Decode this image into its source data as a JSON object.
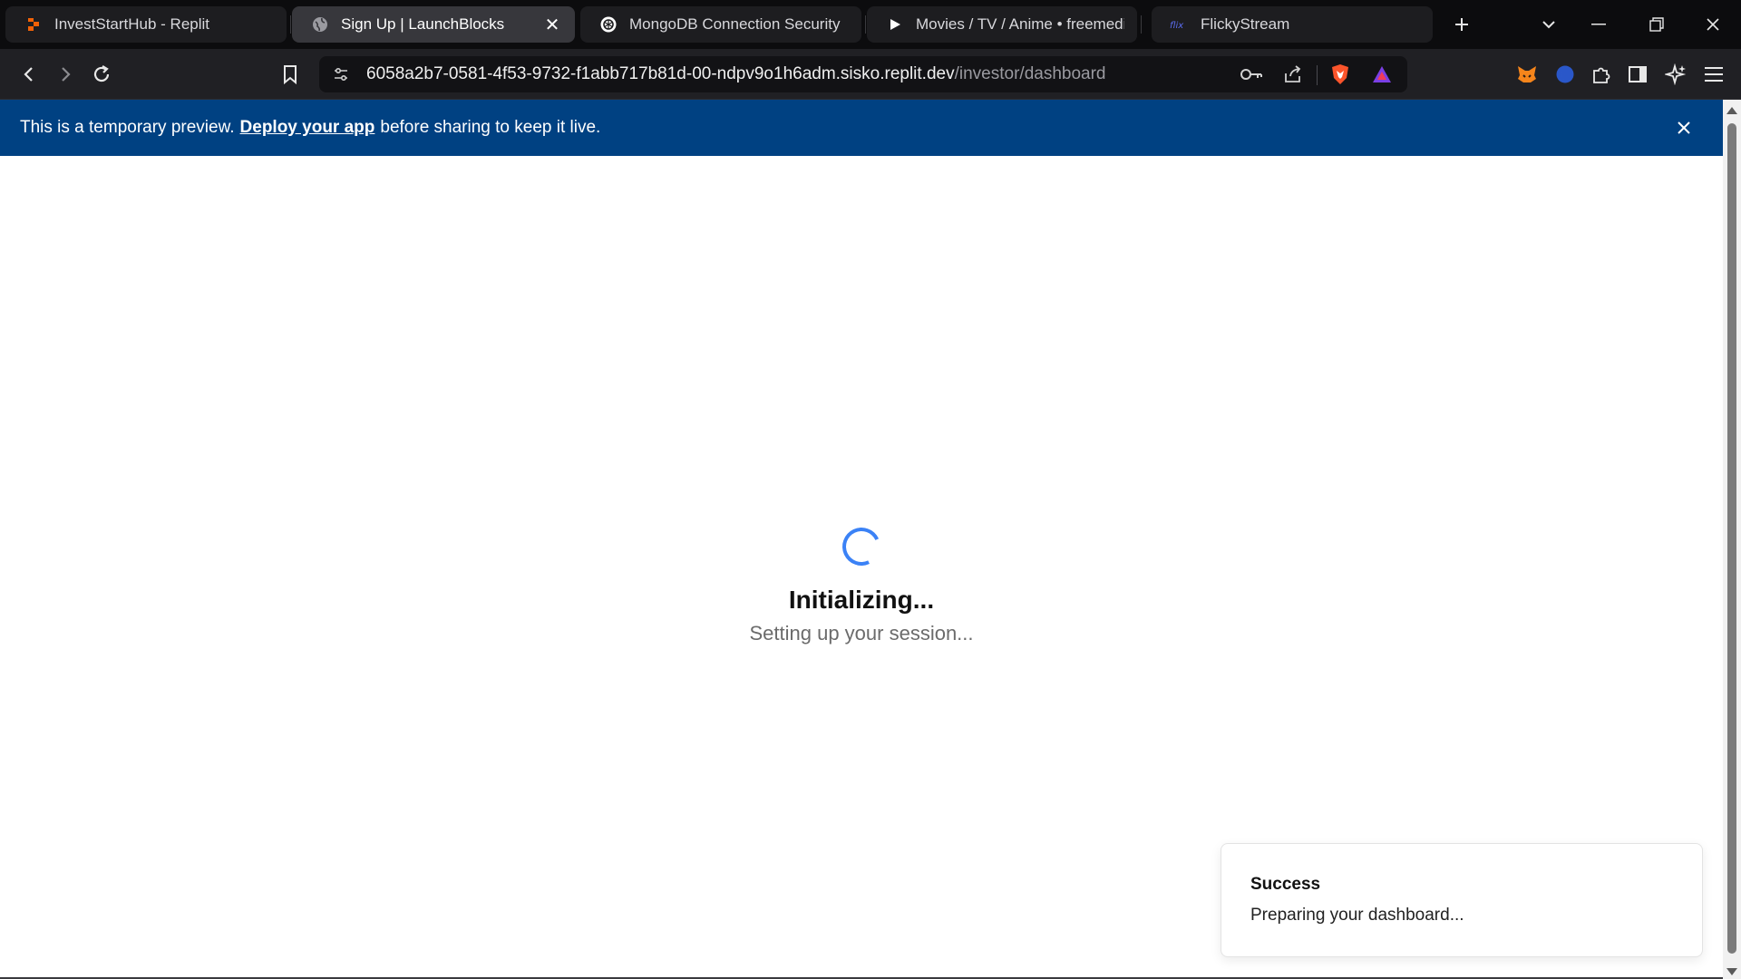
{
  "browser": {
    "tabs": [
      {
        "title": "InvestStartHub - Replit",
        "favicon": "replit-icon",
        "active": false
      },
      {
        "title": "Sign Up | LaunchBlocks",
        "favicon": "globe-icon",
        "active": true
      },
      {
        "title": "MongoDB Connection Security",
        "favicon": "openai-icon",
        "active": false
      },
      {
        "title": "Movies / TV / Anime • freemediaheckyeah",
        "favicon": "play-icon",
        "active": false
      },
      {
        "title": "FlickyStream",
        "favicon": "flicky-icon",
        "active": false
      }
    ],
    "address": {
      "host": "6058a2b7-0581-4f53-9732-f1abb717b81d-00-ndpv9o1h6adm.sisko.replit.dev",
      "path": "/investor/dashboard"
    }
  },
  "banner": {
    "before": "This is a temporary preview.",
    "link": "Deploy your app",
    "after": "before sharing to keep it live."
  },
  "loader": {
    "title": "Initializing...",
    "subtitle": "Setting up your session..."
  },
  "toast": {
    "title": "Success",
    "message": "Preparing your dashboard..."
  },
  "colors": {
    "banner_bg": "#004182",
    "spinner": "#3b82f6",
    "brave_orange": "#fb542b"
  }
}
